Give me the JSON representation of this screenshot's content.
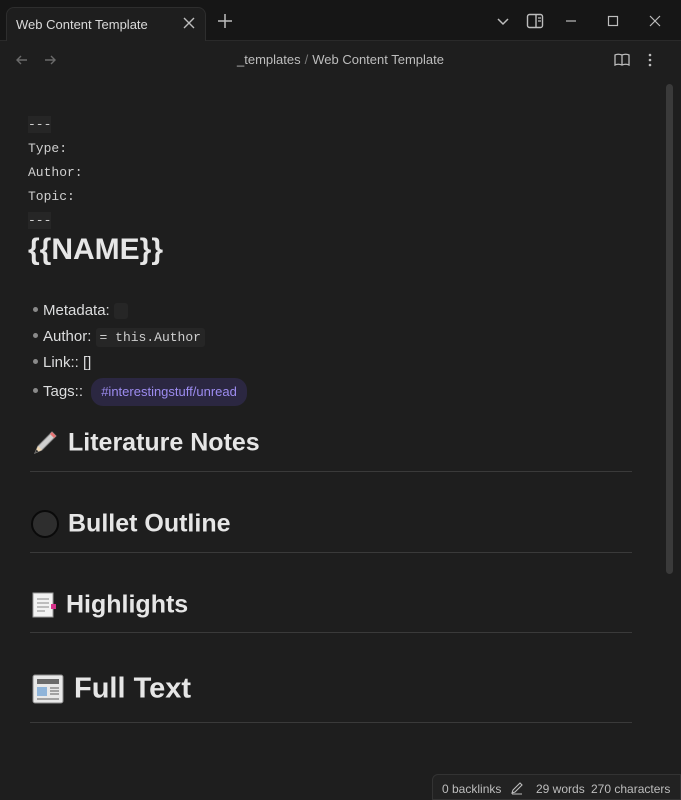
{
  "tab": {
    "title": "Web Content Template"
  },
  "breadcrumb": {
    "folder": "_templates",
    "separator": "/",
    "file": "Web Content Template"
  },
  "frontmatter": {
    "open": "---",
    "type": "Type:",
    "author": "Author:",
    "topic": "Topic:",
    "close": "---"
  },
  "title": "{{NAME}}",
  "bullets": {
    "metadata": "Metadata:",
    "author_label": "Author:",
    "author_code": "= this.Author",
    "link": "Link:: []",
    "tags_label": "Tags::",
    "tag": "#interestingstuff/unread"
  },
  "headings": [
    {
      "text": "Literature Notes",
      "icon": "pencil-icon"
    },
    {
      "text": "Bullet Outline",
      "icon": "black-circle-icon"
    },
    {
      "text": "Highlights",
      "icon": "bookmark-tabs-icon"
    },
    {
      "text": "Full Text",
      "icon": "newspaper-icon"
    }
  ],
  "status": {
    "backlinks": "0 backlinks",
    "words": "29 words",
    "characters": "270 characters"
  },
  "colors": {
    "background": "#1e1e1e",
    "tag_text": "#9d8cf0",
    "tag_bg": "#2b2741"
  }
}
